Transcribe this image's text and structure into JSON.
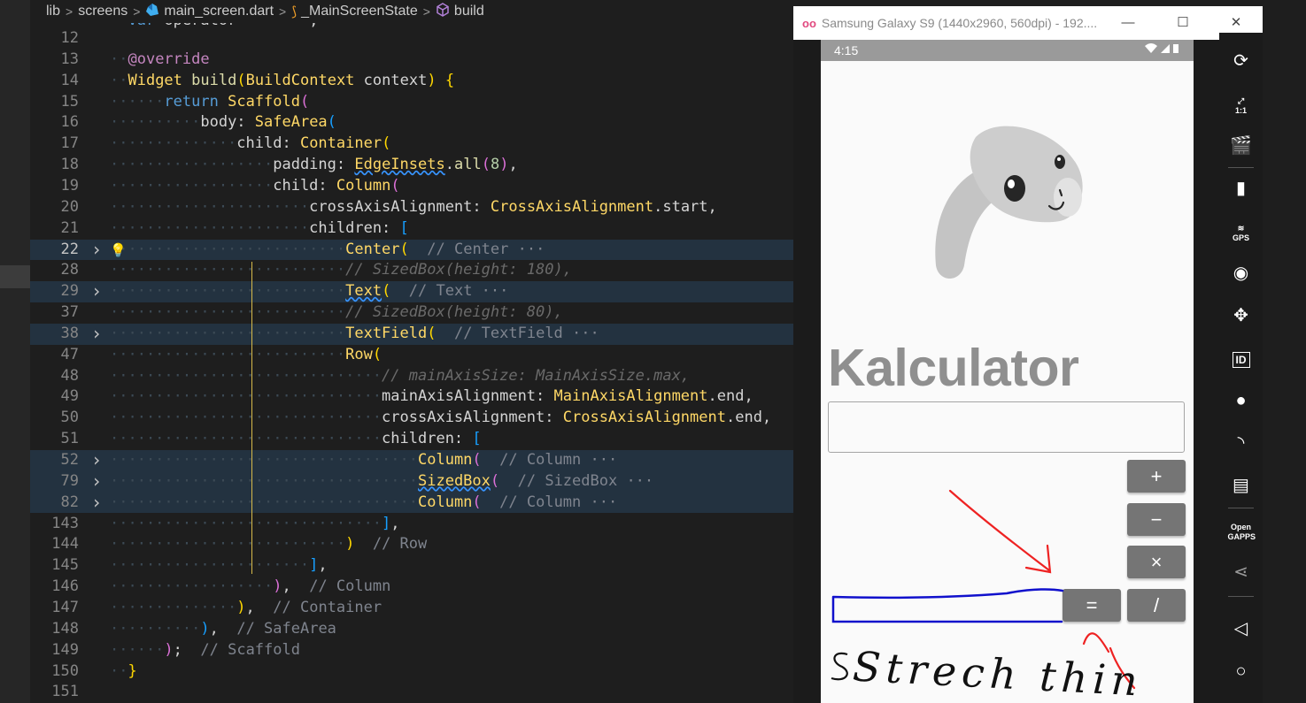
{
  "breadcrumb": [
    "lib",
    "screens",
    "main_screen.dart",
    "_MainScreenState",
    "build"
  ],
  "editor": {
    "lines": [
      {
        "n": "12",
        "d": "",
        "t": []
      },
      {
        "n": "13",
        "d": "··",
        "t": [
          [
            "at",
            "@override"
          ]
        ]
      },
      {
        "n": "14",
        "d": "··",
        "t": [
          [
            "ty",
            "Widget"
          ],
          [
            "pr",
            " "
          ],
          [
            "fn",
            "build"
          ],
          [
            "b1",
            "("
          ],
          [
            "ty",
            "BuildContext"
          ],
          [
            "pr",
            " context"
          ],
          [
            "b1",
            ")"
          ],
          [
            "pr",
            " "
          ],
          [
            "b1",
            "{"
          ]
        ]
      },
      {
        "n": "15",
        "d": "······",
        "t": [
          [
            "kw",
            "return"
          ],
          [
            "pr",
            " "
          ],
          [
            "ty",
            "Scaffold"
          ],
          [
            "b2",
            "("
          ]
        ]
      },
      {
        "n": "16",
        "d": "··········",
        "t": [
          [
            "pr",
            "body: "
          ],
          [
            "ty",
            "SafeArea"
          ],
          [
            "b3",
            "("
          ]
        ]
      },
      {
        "n": "17",
        "d": "··············",
        "t": [
          [
            "pr",
            "child: "
          ],
          [
            "ty",
            "Container"
          ],
          [
            "b1",
            "("
          ]
        ]
      },
      {
        "n": "18",
        "d": "··················",
        "t": [
          [
            "pr",
            "padding: "
          ],
          [
            "ty",
            "EdgeInsets",
            "sq"
          ],
          [
            "pr",
            "."
          ],
          [
            "fn",
            "all"
          ],
          [
            "b2",
            "("
          ],
          [
            "num",
            "8"
          ],
          [
            "b2",
            ")"
          ],
          [
            "pr",
            ","
          ]
        ]
      },
      {
        "n": "19",
        "d": "··················",
        "t": [
          [
            "pr",
            "child: "
          ],
          [
            "ty",
            "Column"
          ],
          [
            "b2",
            "("
          ]
        ]
      },
      {
        "n": "20",
        "d": "······················",
        "t": [
          [
            "pr",
            "crossAxisAlignment: "
          ],
          [
            "ty",
            "CrossAxisAlignment"
          ],
          [
            "pr",
            ".start,"
          ]
        ]
      },
      {
        "n": "21",
        "d": "······················",
        "t": [
          [
            "pr",
            "children: "
          ],
          [
            "b3",
            "["
          ]
        ]
      },
      {
        "n": "22",
        "d": "··························",
        "t": [
          [
            "ty",
            "Center"
          ],
          [
            "b1",
            "("
          ],
          [
            "pr",
            "  "
          ],
          [
            "cm",
            "// Center ···"
          ]
        ],
        "hl": true,
        "fold": true,
        "bulb": true,
        "cur": true
      },
      {
        "n": "28",
        "d": "··························",
        "t": [
          [
            "cmi",
            "// SizedBox(height: 180),"
          ]
        ]
      },
      {
        "n": "29",
        "d": "··························",
        "t": [
          [
            "ty",
            "Text",
            "sq"
          ],
          [
            "b1",
            "("
          ],
          [
            "pr",
            "  "
          ],
          [
            "cm",
            "// Text ···"
          ]
        ],
        "hl": true,
        "fold": true
      },
      {
        "n": "37",
        "d": "··························",
        "t": [
          [
            "cmi",
            "// SizedBox(height: 80),"
          ]
        ]
      },
      {
        "n": "38",
        "d": "··························",
        "t": [
          [
            "ty",
            "TextField"
          ],
          [
            "b1",
            "("
          ],
          [
            "pr",
            "  "
          ],
          [
            "cm",
            "// TextField ···"
          ]
        ],
        "hl": true,
        "fold": true
      },
      {
        "n": "47",
        "d": "··························",
        "t": [
          [
            "ty",
            "Row"
          ],
          [
            "b1",
            "("
          ]
        ]
      },
      {
        "n": "48",
        "d": "······························",
        "t": [
          [
            "cmi",
            "// mainAxisSize: MainAxisSize.max,"
          ]
        ]
      },
      {
        "n": "49",
        "d": "······························",
        "t": [
          [
            "pr",
            "mainAxisAlignment: "
          ],
          [
            "ty",
            "MainAxisAlignment"
          ],
          [
            "pr",
            ".end,"
          ]
        ]
      },
      {
        "n": "50",
        "d": "······························",
        "t": [
          [
            "pr",
            "crossAxisAlignment: "
          ],
          [
            "ty",
            "CrossAxisAlignment"
          ],
          [
            "pr",
            ".end,"
          ]
        ]
      },
      {
        "n": "51",
        "d": "······························",
        "t": [
          [
            "pr",
            "children: "
          ],
          [
            "b3",
            "["
          ]
        ]
      },
      {
        "n": "52",
        "d": "··································",
        "t": [
          [
            "ty",
            "Column"
          ],
          [
            "b2",
            "("
          ],
          [
            "pr",
            "  "
          ],
          [
            "cm",
            "// Column ···"
          ]
        ],
        "hl": true,
        "fold": true
      },
      {
        "n": "79",
        "d": "··································",
        "t": [
          [
            "ty",
            "SizedBox",
            "sq"
          ],
          [
            "b2",
            "("
          ],
          [
            "pr",
            "  "
          ],
          [
            "cm",
            "// SizedBox ···"
          ]
        ],
        "hl": true,
        "fold": true
      },
      {
        "n": "82",
        "d": "··································",
        "t": [
          [
            "ty",
            "Column"
          ],
          [
            "b2",
            "("
          ],
          [
            "pr",
            "  "
          ],
          [
            "cm",
            "// Column ···"
          ]
        ],
        "hl": true,
        "fold": true
      },
      {
        "n": "143",
        "d": "······························",
        "t": [
          [
            "b3",
            "]"
          ],
          [
            "pr",
            ","
          ]
        ]
      },
      {
        "n": "144",
        "d": "··························",
        "t": [
          [
            "b1",
            ")"
          ],
          [
            "pr",
            "  "
          ],
          [
            "cm",
            "// Row"
          ]
        ]
      },
      {
        "n": "145",
        "d": "······················",
        "t": [
          [
            "b3",
            "]"
          ],
          [
            "pr",
            ","
          ]
        ]
      },
      {
        "n": "146",
        "d": "··················",
        "t": [
          [
            "b2",
            ")"
          ],
          [
            "pr",
            ",  "
          ],
          [
            "cm",
            "// Column"
          ]
        ]
      },
      {
        "n": "147",
        "d": "··············",
        "t": [
          [
            "b1",
            ")"
          ],
          [
            "pr",
            ",  "
          ],
          [
            "cm",
            "// Container"
          ]
        ]
      },
      {
        "n": "148",
        "d": "··········",
        "t": [
          [
            "b3",
            ")"
          ],
          [
            "pr",
            ",  "
          ],
          [
            "cm",
            "// SafeArea"
          ]
        ]
      },
      {
        "n": "149",
        "d": "······",
        "t": [
          [
            "b2",
            ")"
          ],
          [
            "pr",
            ";  "
          ],
          [
            "cm",
            "// Scaffold"
          ]
        ]
      },
      {
        "n": "150",
        "d": "··",
        "t": [
          [
            "b1",
            "}"
          ]
        ]
      },
      {
        "n": "151",
        "d": "",
        "t": []
      }
    ]
  },
  "emulator": {
    "window_title": "Samsung Galaxy S9 (1440x2960, 560dpi) - 192....",
    "status_time": "4:15",
    "app_title": "Kalculator",
    "textfield_value": "",
    "buttons": [
      "+",
      "−",
      "×",
      "/",
      "="
    ],
    "annotation_text": "Strech thin",
    "colors": {
      "annotation_red": "#ee2222",
      "annotation_blue": "#1010cc",
      "button_bg": "#757575"
    },
    "toolbar_icons": [
      "rotate-icon",
      "aspect-ratio-icon",
      "screen-record-icon",
      "battery-icon",
      "gps-icon",
      "camera-icon",
      "move-icon",
      "id-icon",
      "media-icon",
      "broadcast-icon",
      "message-icon",
      "open-gapps-icon",
      "share-icon",
      "back-icon",
      "home-icon"
    ],
    "toolbar_text": {
      "ratio": "1:1",
      "gps": "GPS",
      "id": "ID",
      "gapps": "Open GAPPS"
    }
  }
}
